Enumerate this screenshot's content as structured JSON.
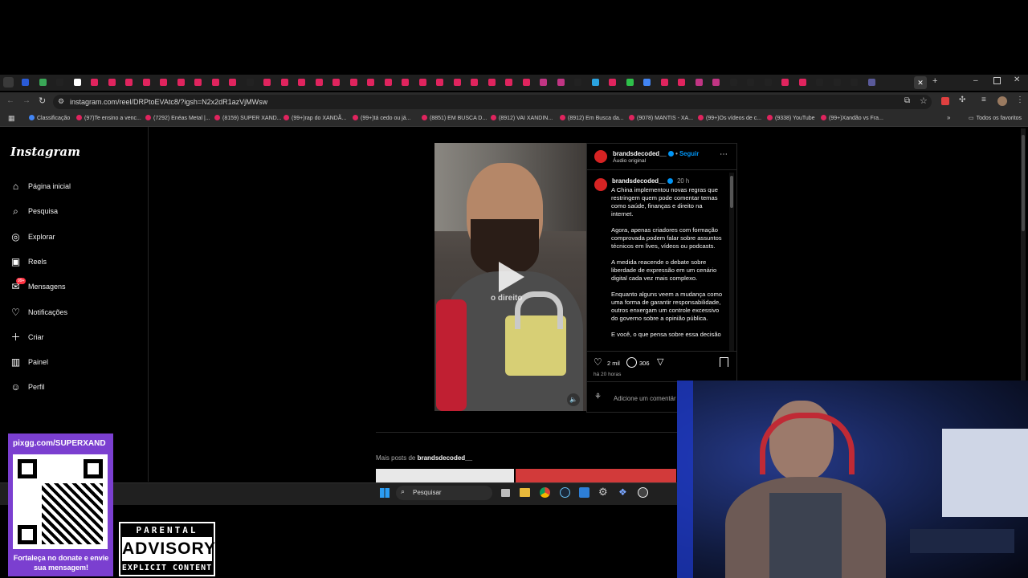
{
  "browser": {
    "url": "instagram.com/reel/DRPtoEVAtc8/?igsh=N2x2dR1azVjMWsw",
    "bookmarks": [
      "Classificação",
      "(97)Te ensino a venc...",
      "(7292) Enéas Metal |...",
      "(8159) SUPER XAND...",
      "(99+)rap do XANDÃ...",
      "(99+)tá cedo ou já...",
      "(8851) EM BUSCA D...",
      "(8912) VAI XANDIN...",
      "(8912) Em Busca da...",
      "(9078) MANTIS - XA...",
      "(99+)Os vídeos de c...",
      "(9338) YouTube",
      "(99+)Xandão vs Fra..."
    ],
    "all_bookmarks": "Todos os favoritos"
  },
  "instagram": {
    "logo": "Instagram",
    "nav": [
      {
        "label": "Página inicial",
        "icon": "home-icon"
      },
      {
        "label": "Pesquisa",
        "icon": "search-icon"
      },
      {
        "label": "Explorar",
        "icon": "compass-icon"
      },
      {
        "label": "Reels",
        "icon": "reels-icon"
      },
      {
        "label": "Mensagens",
        "icon": "messenger-icon",
        "badge": "99+"
      },
      {
        "label": "Notificações",
        "icon": "heart-icon"
      },
      {
        "label": "Criar",
        "icon": "plus-icon"
      },
      {
        "label": "Painel",
        "icon": "dashboard-icon"
      },
      {
        "label": "Perfil",
        "icon": "avatar-icon"
      }
    ],
    "post": {
      "username": "brandsdecoded__",
      "follow": "Seguir",
      "audio": "Áudio original",
      "time_ago": "20 h",
      "video_overlay_text": "o direito",
      "caption": [
        "A China implementou novas regras que restringem quem pode comentar temas como saúde, finanças e direito na internet.",
        "Agora, apenas criadores com formação comprovada podem falar sobre assuntos técnicos em lives, vídeos ou podcasts.",
        "A medida reacende o debate sobre liberdade de expressão em um cenário digital cada vez mais complexo.",
        "Enquanto alguns veem a mudança como uma forma de garantir responsabilidade, outros enxergam um controle excessivo do governo sobre a opinião pública.",
        "E você, o que pensa sobre essa decisão"
      ],
      "likes": "2 mil",
      "comments": "306",
      "posted": "há 20 horas",
      "comment_placeholder": "Adicione um comentár"
    },
    "more_posts_prefix": "Mais posts de",
    "more_posts_user": "brandsdecoded__"
  },
  "taskbar": {
    "search_placeholder": "Pesquisar"
  },
  "overlay": {
    "donate_url": "pixgg.com/SUPERXAND",
    "donate_text": "Fortaleça no donate e envie sua mensagem!",
    "parental_1": "PARENTAL",
    "parental_2": "ADVISORY",
    "parental_3": "EXPLICIT CONTENT"
  },
  "colors": {
    "accent_blue": "#0095f6",
    "badge_red": "#ff3040",
    "qr_purple": "#7b3fd0"
  }
}
